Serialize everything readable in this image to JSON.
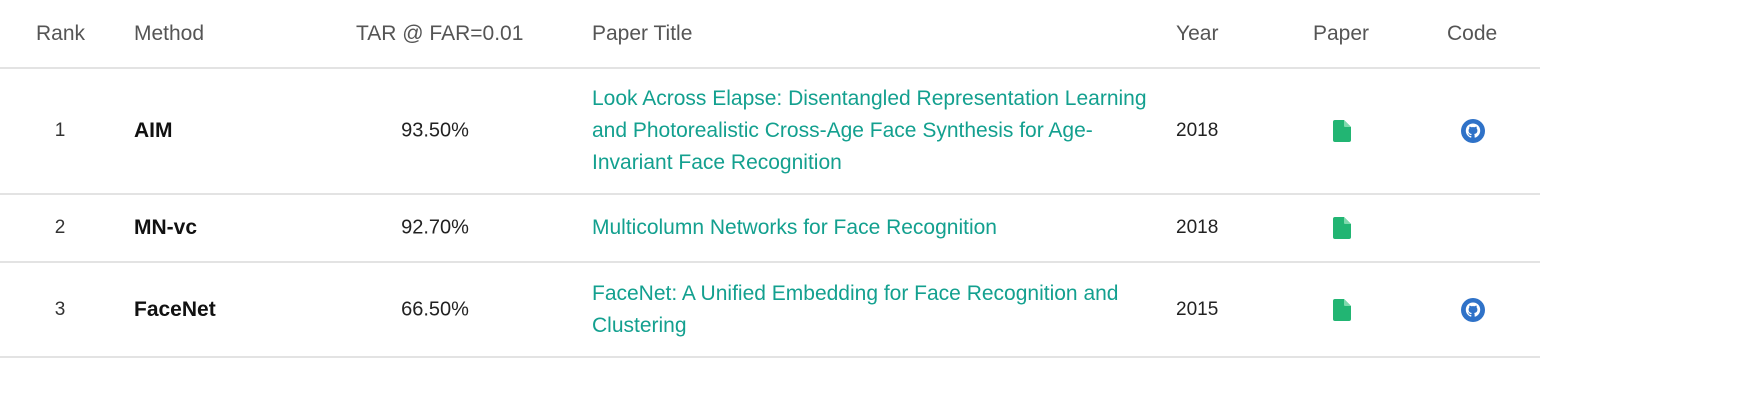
{
  "table": {
    "headers": {
      "rank": "Rank",
      "method": "Method",
      "metric": "TAR @ FAR=0.01",
      "paper_title": "Paper Title",
      "year": "Year",
      "paper": "Paper",
      "code": "Code"
    },
    "rows": [
      {
        "rank": "1",
        "method": "AIM",
        "score": "93.50%",
        "title": "Look Across Elapse: Disentangled Representation Learning and Photorealistic Cross-Age Face Synthesis for Age-Invariant Face Recognition",
        "year": "2018",
        "has_code": true
      },
      {
        "rank": "2",
        "method": "MN-vc",
        "score": "92.70%",
        "title": "Multicolumn Networks for Face Recognition",
        "year": "2018",
        "has_code": false
      },
      {
        "rank": "3",
        "method": "FaceNet",
        "score": "66.50%",
        "title": "FaceNet: A Unified Embedding for Face Recognition and Clustering",
        "year": "2015",
        "has_code": true
      }
    ]
  },
  "icons": {
    "paper": "file-icon",
    "code": "github-icon"
  },
  "colors": {
    "link": "#13a08f",
    "paper_icon": "#22b573",
    "code_icon": "#2f72c8",
    "divider": "#e3e3e3"
  }
}
